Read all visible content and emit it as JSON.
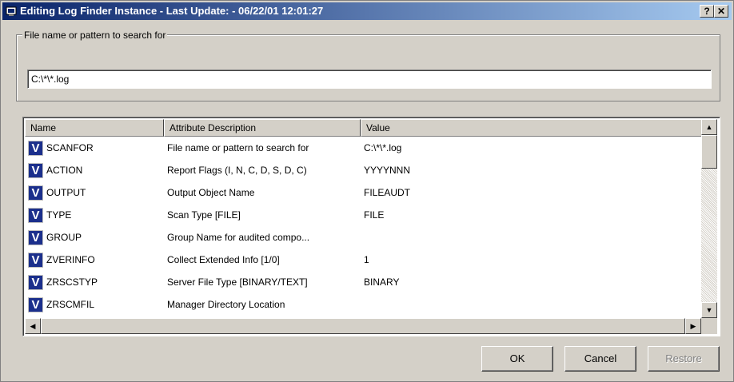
{
  "window": {
    "title": "Editing Log Finder Instance - Last Update: - 06/22/01 12:01:27",
    "help_label": "?",
    "close_label": "✕"
  },
  "search": {
    "group_label": "File name or pattern to search for",
    "value": "C:\\*\\*.log"
  },
  "list": {
    "columns": [
      "Name",
      "Attribute Description",
      "Value"
    ],
    "icon_letter": "V",
    "rows": [
      {
        "name": "SCANFOR",
        "attr": "File name or pattern to search for",
        "value": "C:\\*\\*.log"
      },
      {
        "name": "ACTION",
        "attr": "Report Flags (I, N, C, D, S, D, C)",
        "value": "YYYYNNN"
      },
      {
        "name": "OUTPUT",
        "attr": "Output Object Name",
        "value": "FILEAUDT"
      },
      {
        "name": "TYPE",
        "attr": "Scan Type [FILE]",
        "value": "FILE"
      },
      {
        "name": "GROUP",
        "attr": "Group Name for audited compo...",
        "value": ""
      },
      {
        "name": "ZVERINFO",
        "attr": "Collect Extended Info [1/0]",
        "value": "1"
      },
      {
        "name": "ZRSCSTYP",
        "attr": "Server File Type [BINARY/TEXT]",
        "value": "BINARY"
      },
      {
        "name": "ZRSCMFIL",
        "attr": "Manager Directory Location",
        "value": ""
      }
    ]
  },
  "buttons": {
    "ok": "OK",
    "cancel": "Cancel",
    "restore": "Restore"
  }
}
